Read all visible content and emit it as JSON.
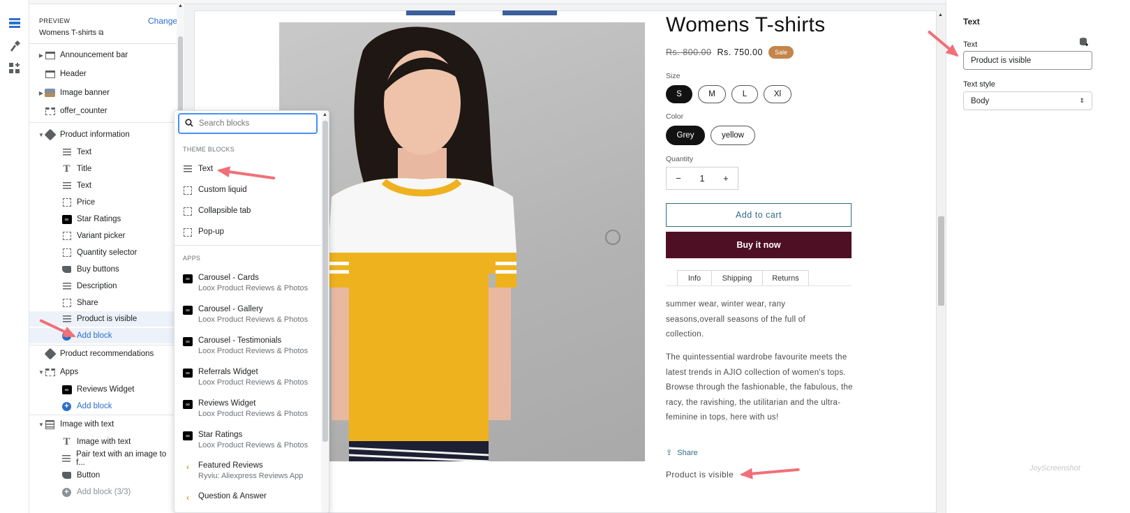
{
  "sidebar": {
    "preview_label": "PREVIEW",
    "change_label": "Change",
    "preview_value": "Womens T-shirts",
    "items": [
      {
        "label": "Announcement bar"
      },
      {
        "label": "Header"
      },
      {
        "label": "Image banner"
      },
      {
        "label": "offer_counter"
      },
      {
        "label": "Product information"
      },
      {
        "label": "Text"
      },
      {
        "label": "Title"
      },
      {
        "label": "Text"
      },
      {
        "label": "Price"
      },
      {
        "label": "Star Ratings"
      },
      {
        "label": "Variant picker"
      },
      {
        "label": "Quantity selector"
      },
      {
        "label": "Buy buttons"
      },
      {
        "label": "Description"
      },
      {
        "label": "Share"
      },
      {
        "label": "Product is visible"
      },
      {
        "label": "Add block"
      },
      {
        "label": "Product recommendations"
      },
      {
        "label": "Apps"
      },
      {
        "label": "Reviews Widget"
      },
      {
        "label": "Add block"
      },
      {
        "label": "Image with text"
      },
      {
        "label": "Image with text"
      },
      {
        "label": "Pair text with an image to f..."
      },
      {
        "label": "Button"
      },
      {
        "label": "Add block (3/3)"
      }
    ]
  },
  "popup": {
    "search_placeholder": "Search blocks",
    "theme_heading": "THEME BLOCKS",
    "theme_blocks": [
      "Text",
      "Custom liquid",
      "Collapsible tab",
      "Pop-up"
    ],
    "apps_heading": "APPS",
    "apps": [
      {
        "name": "Carousel - Cards",
        "vendor": "Loox Product Reviews & Photos"
      },
      {
        "name": "Carousel - Gallery",
        "vendor": "Loox Product Reviews & Photos"
      },
      {
        "name": "Carousel - Testimonials",
        "vendor": "Loox Product Reviews & Photos"
      },
      {
        "name": "Referrals Widget",
        "vendor": "Loox Product Reviews & Photos"
      },
      {
        "name": "Reviews Widget",
        "vendor": "Loox Product Reviews & Photos"
      },
      {
        "name": "Star Ratings",
        "vendor": "Loox Product Reviews & Photos"
      },
      {
        "name": "Featured Reviews",
        "vendor": "Ryviu: Aliexpress Reviews App"
      },
      {
        "name": "Question & Answer",
        "vendor": ""
      }
    ]
  },
  "product": {
    "title": "Womens T-shirts",
    "old_price": "Rs. 800.00",
    "price": "Rs. 750.00",
    "sale_badge": "Sale",
    "size_label": "Size",
    "sizes": [
      "S",
      "M",
      "L",
      "Xl"
    ],
    "selected_size": "S",
    "color_label": "Color",
    "colors": [
      "Grey",
      "yellow"
    ],
    "selected_color": "Grey",
    "quantity_label": "Quantity",
    "quantity": "1",
    "minus": "−",
    "plus": "+",
    "add_to_cart": "Add to cart",
    "buy_now": "Buy it now",
    "tabs": [
      "Info",
      "Shipping",
      "Returns"
    ],
    "desc_1": "summer wear, winter wear, rany seasons,overall seasons of the full of collection.",
    "desc_2": "The quintessential wardrobe favourite meets the latest trends in AJIO collection of women's tops. Browse through the fashionable, the fabulous, the racy, the ravishing, the utilitarian and the ultra-feminine in tops, here with us!",
    "share": "Share",
    "custom_text": "Product is visible"
  },
  "settings": {
    "title": "Text",
    "text_label": "Text",
    "text_value": "Product is visible",
    "style_label": "Text style",
    "style_value": "Body"
  },
  "watermark": "JoyScreenshot",
  "colors": {
    "accent": "#2c6ecb",
    "buy_now_bg": "#4e0f24",
    "sale_badge": "#c4844a",
    "annotation_arrow": "#f07078"
  }
}
